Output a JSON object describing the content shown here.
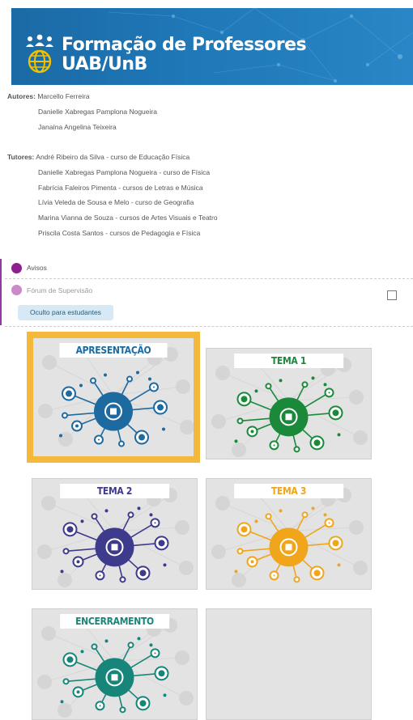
{
  "banner": {
    "title_line1": "Formação de Professores",
    "title_line2": "UAB/UnB",
    "logo_icon": "globe-people-icon"
  },
  "authors": {
    "label": "Autores:",
    "names": [
      "Marcello Ferreira",
      "Danielle Xabregas Pamplona Nogueira",
      "Janaína Angelina Teixeira"
    ]
  },
  "tutors": {
    "label": "Tutores:",
    "names": [
      "André Ribeiro da Silva - curso de Educação Física",
      "Danielle Xabregas Pamplona Nogueira - curso de Física",
      "Fabrícia Faleiros Pimenta - cursos de Letras e Música",
      "Lívia Veleda de Sousa e Melo - curso de Geografia",
      "Marina Vianna de Souza - cursos de Artes Visuais e Teatro",
      "Priscila Costa Santos  - cursos de Pedagogia e Física"
    ]
  },
  "activities": [
    {
      "label": "Avisos",
      "icon": "forum-icon",
      "color": "#8e1f8f"
    },
    {
      "label": "Fórum de Supervisão",
      "icon": "forum-icon",
      "color": "#c98ac9",
      "badge": "Oculto para estudantes"
    }
  ],
  "tiles": [
    {
      "label": "APRESENTAÇÃO",
      "color": "#1c6aa0",
      "icon": "hand-click-icon",
      "selected": true
    },
    {
      "label": "TEMA 1",
      "color": "#1a8a3a",
      "icon": "laptop-idea-icon",
      "selected": false
    },
    {
      "label": "TEMA 2",
      "color": "#3e3a8c",
      "icon": "gears-hand-icon",
      "selected": false
    },
    {
      "label": "TEMA 3",
      "color": "#f0a51b",
      "icon": "lightbulb-icon",
      "selected": false
    },
    {
      "label": "ENCERRAMENTO",
      "color": "#17857a",
      "icon": "chart-magnifier-icon",
      "selected": false
    },
    {
      "label": "",
      "color": "#e3e3e3",
      "icon": "",
      "selected": false
    }
  ]
}
